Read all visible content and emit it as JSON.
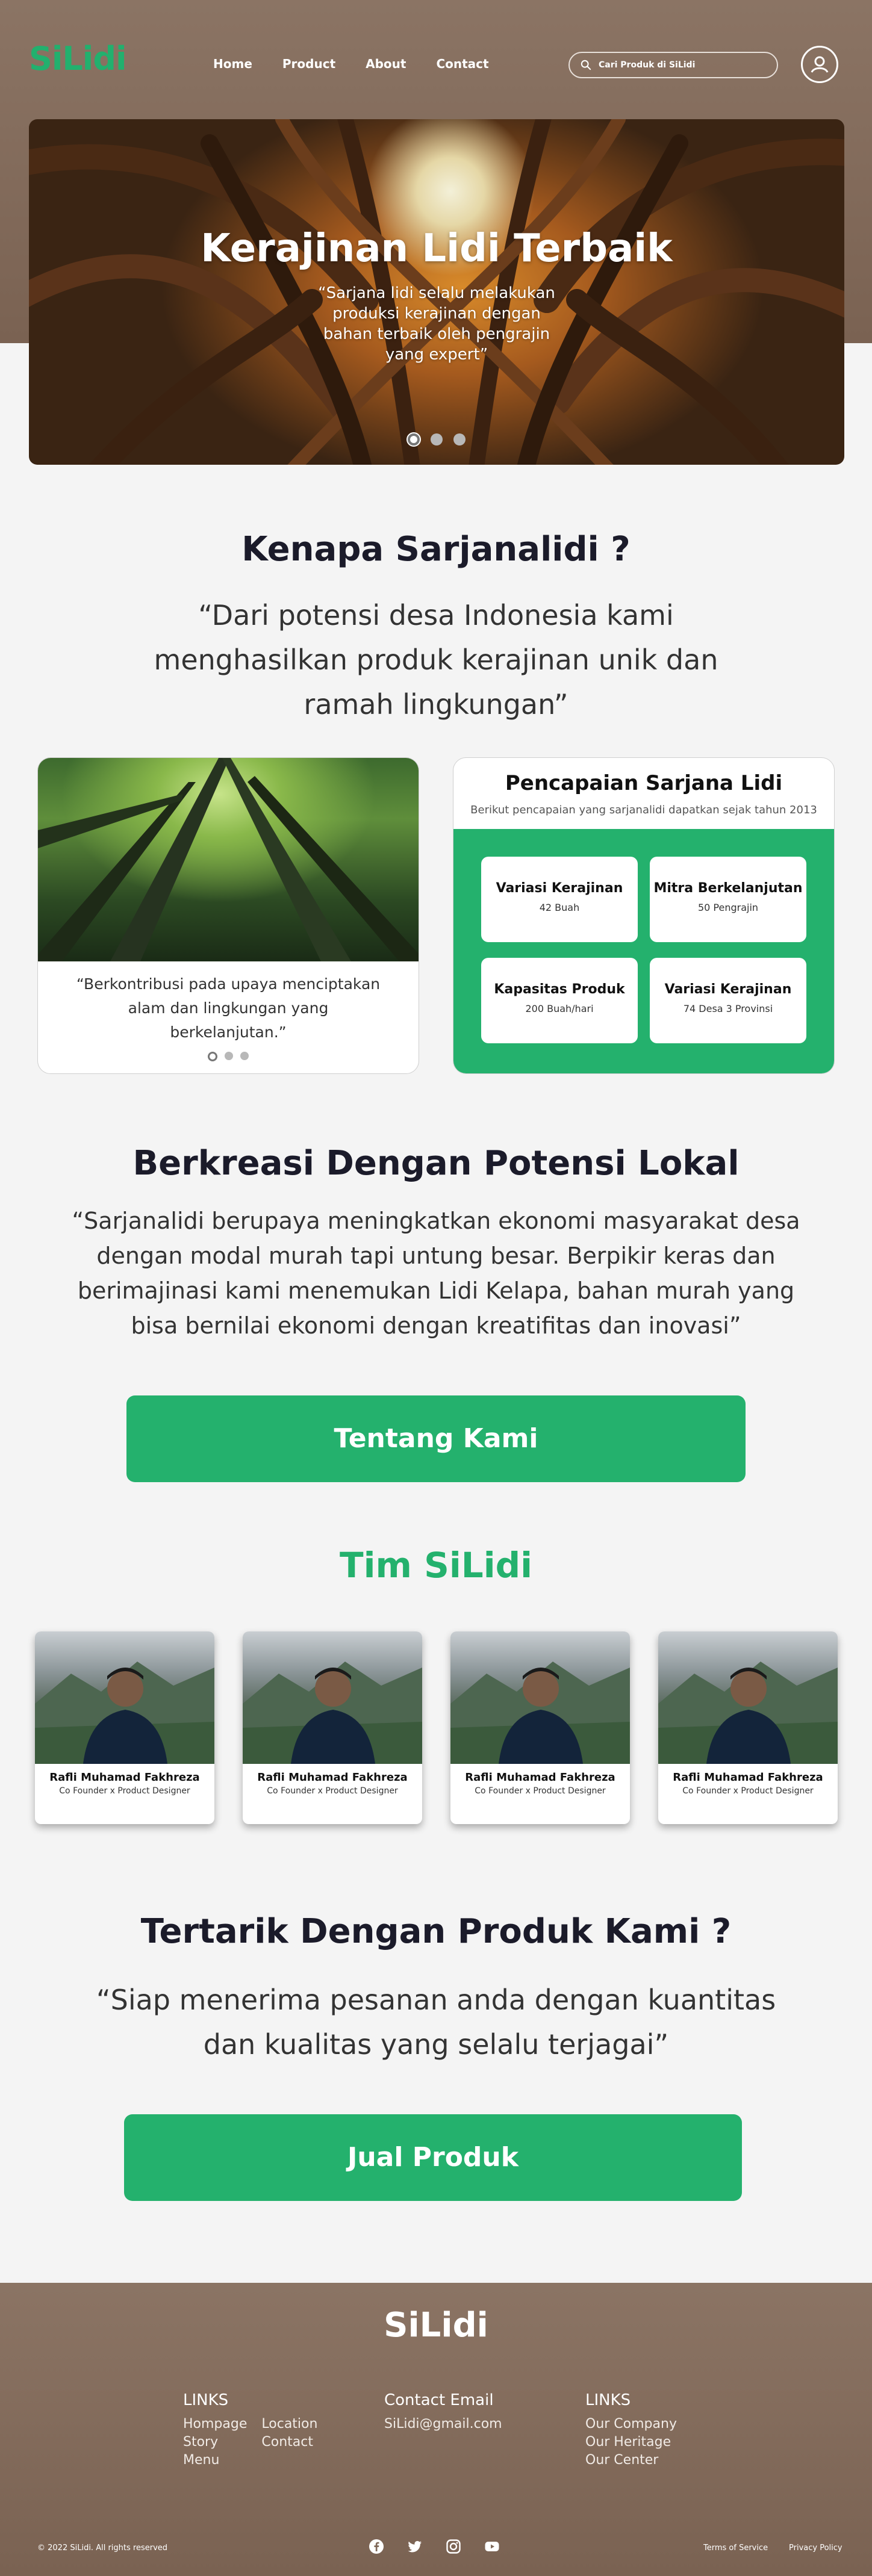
{
  "brand": {
    "name": "SiLidi",
    "accent": "#22b06e",
    "header_bg": "#8b7464"
  },
  "nav": {
    "items": [
      "Home",
      "Product",
      "About",
      "Contact"
    ]
  },
  "search": {
    "placeholder": "Cari Produk di SiLidi"
  },
  "icons": {
    "search": "search-icon",
    "user": "user-circle-icon"
  },
  "hero": {
    "title": "Kerajinan Lidi Terbaik",
    "subtitle": "“Sarjana lidi selalu melakukan produksi kerajinan dengan bahan terbaik oleh pengrajin yang expert”",
    "slide_count": 3,
    "active_slide": 1
  },
  "why": {
    "title": "Kenapa Sarjanalidi ?",
    "quote": "“Dari potensi desa Indonesia kami menghasilkan produk kerajinan unik dan ramah lingkungan”"
  },
  "nature_card": {
    "caption": "“Berkontribusi pada upaya menciptakan alam dan lingkungan yang berkelanjutan.”",
    "slide_count": 3,
    "active_slide": 1
  },
  "achievements": {
    "title": "Pencapaian Sarjana Lidi",
    "subtitle": "Berikut pencapaian yang sarjanalidi dapatkan sejak tahun 2013",
    "items": [
      {
        "label": "Variasi Kerajinan",
        "value": "42 Buah"
      },
      {
        "label": "Mitra Berkelanjutan",
        "value": "50 Pengrajin"
      },
      {
        "label": "Kapasitas Produk",
        "value": "200 Buah/hari"
      },
      {
        "label": "Variasi Kerajinan",
        "value": "74 Desa 3 Provinsi"
      }
    ]
  },
  "local": {
    "title": "Berkreasi Dengan Potensi Lokal",
    "quote": "“Sarjanalidi berupaya meningkatkan ekonomi masyarakat desa dengan modal murah tapi untung besar. Berpikir keras dan berimajinasi kami menemukan Lidi Kelapa, bahan murah yang bisa bernilai ekonomi dengan kreatifitas dan inovasi”",
    "button": "Tentang Kami"
  },
  "team": {
    "title": "Tim SiLidi",
    "members": [
      {
        "name": "Rafli Muhamad Fakhreza",
        "role": "Co Founder x Product Designer"
      },
      {
        "name": "Rafli Muhamad Fakhreza",
        "role": "Co Founder x Product Designer"
      },
      {
        "name": "Rafli Muhamad Fakhreza",
        "role": "Co Founder x Product Designer"
      },
      {
        "name": "Rafli Muhamad Fakhreza",
        "role": "Co Founder x Product Designer"
      }
    ]
  },
  "cta": {
    "title": "Tertarik Dengan Produk Kami ?",
    "quote": "“Siap menerima pesanan anda dengan kuantitas dan kualitas yang selalu terjagai”",
    "button": "Jual Produk"
  },
  "footer": {
    "logo": "SiLidi",
    "col1": {
      "heading": "LINKS",
      "links_a": [
        "Hompage",
        "Story",
        "Menu"
      ],
      "links_b": [
        "Location",
        "Contact"
      ]
    },
    "col2": {
      "heading": "Contact Email",
      "email": "SiLidi@gmail.com"
    },
    "col3": {
      "heading": "LINKS",
      "links": [
        "Our Company",
        "Our Heritage",
        "Our Center"
      ]
    },
    "copyright": "© 2022 SiLidi. All rights reserved",
    "social": [
      "facebook-icon",
      "twitter-icon",
      "instagram-icon",
      "youtube-icon"
    ],
    "legal": [
      "Terms of Service",
      "Privacy Policy"
    ]
  }
}
